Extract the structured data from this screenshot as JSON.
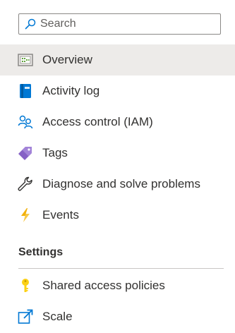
{
  "search": {
    "placeholder": "Search",
    "value": ""
  },
  "nav": {
    "items": [
      {
        "label": "Overview",
        "icon": "overview-icon",
        "selected": true
      },
      {
        "label": "Activity log",
        "icon": "activity-log-icon"
      },
      {
        "label": "Access control (IAM)",
        "icon": "access-control-icon"
      },
      {
        "label": "Tags",
        "icon": "tag-icon"
      },
      {
        "label": "Diagnose and solve problems",
        "icon": "wrench-icon"
      },
      {
        "label": "Events",
        "icon": "lightning-icon"
      }
    ]
  },
  "settings": {
    "header": "Settings",
    "items": [
      {
        "label": "Shared access policies",
        "icon": "key-icon"
      },
      {
        "label": "Scale",
        "icon": "scale-icon"
      }
    ]
  },
  "colors": {
    "selected_background": "#edebe9",
    "accent_blue": "#0078d4",
    "tag_purple": "#8661c5",
    "key_yellow": "#fcd116",
    "lightning_yellow": "#f7c948"
  }
}
